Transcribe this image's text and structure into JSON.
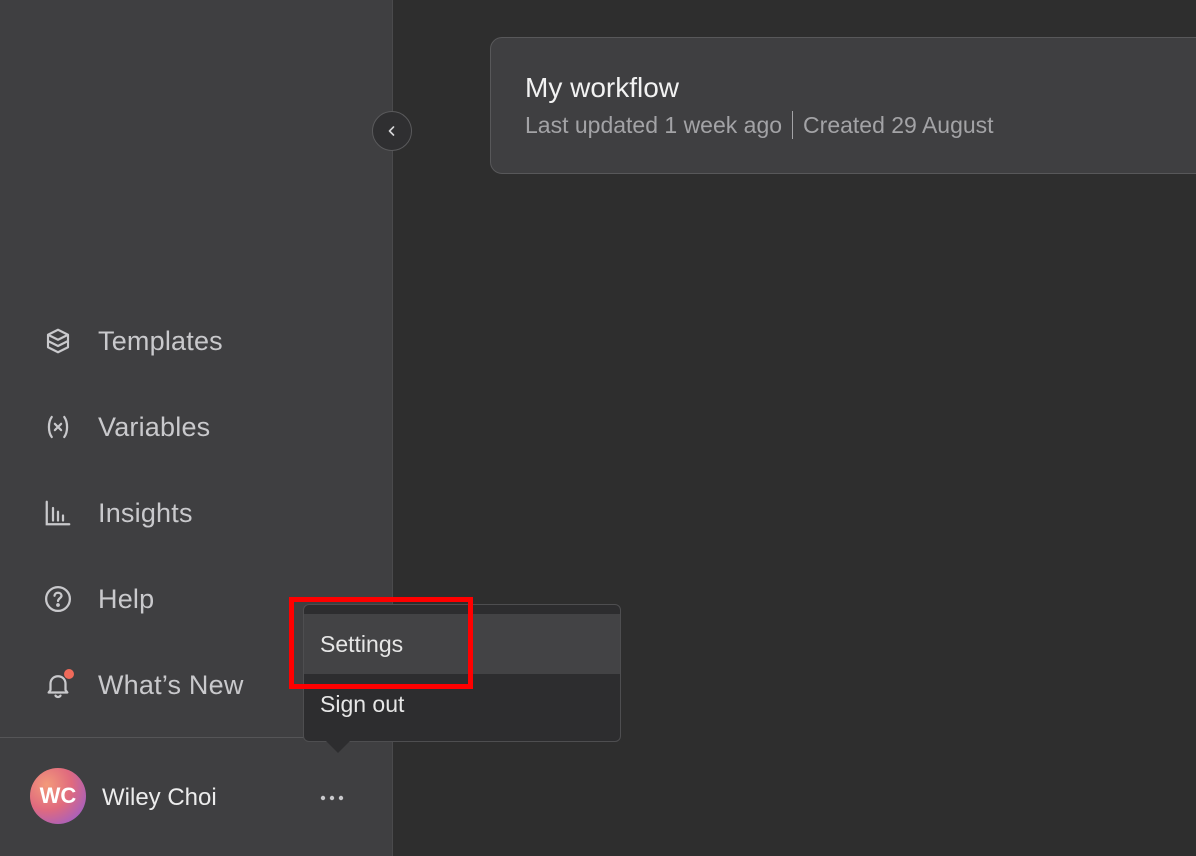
{
  "sidebar": {
    "nav_items": [
      {
        "label": "Templates",
        "icon": "templates-icon"
      },
      {
        "label": "Variables",
        "icon": "variables-icon"
      },
      {
        "label": "Insights",
        "icon": "insights-icon"
      },
      {
        "label": "Help",
        "icon": "help-icon"
      },
      {
        "label": "What’s New",
        "icon": "bell-icon",
        "has_notification": true
      }
    ],
    "user": {
      "initials": "WC",
      "name": "Wiley Choi"
    }
  },
  "workflow": {
    "title": "My workflow",
    "last_updated": "Last updated 1 week ago",
    "created": "Created 29 August"
  },
  "user_menu": {
    "items": [
      "Settings",
      "Sign out"
    ],
    "highlighted": "Settings"
  },
  "colors": {
    "sidebar_bg": "#3f3f41",
    "main_bg": "#2e2e2e",
    "notification": "#f06a5a",
    "highlight": "#ff0000"
  }
}
